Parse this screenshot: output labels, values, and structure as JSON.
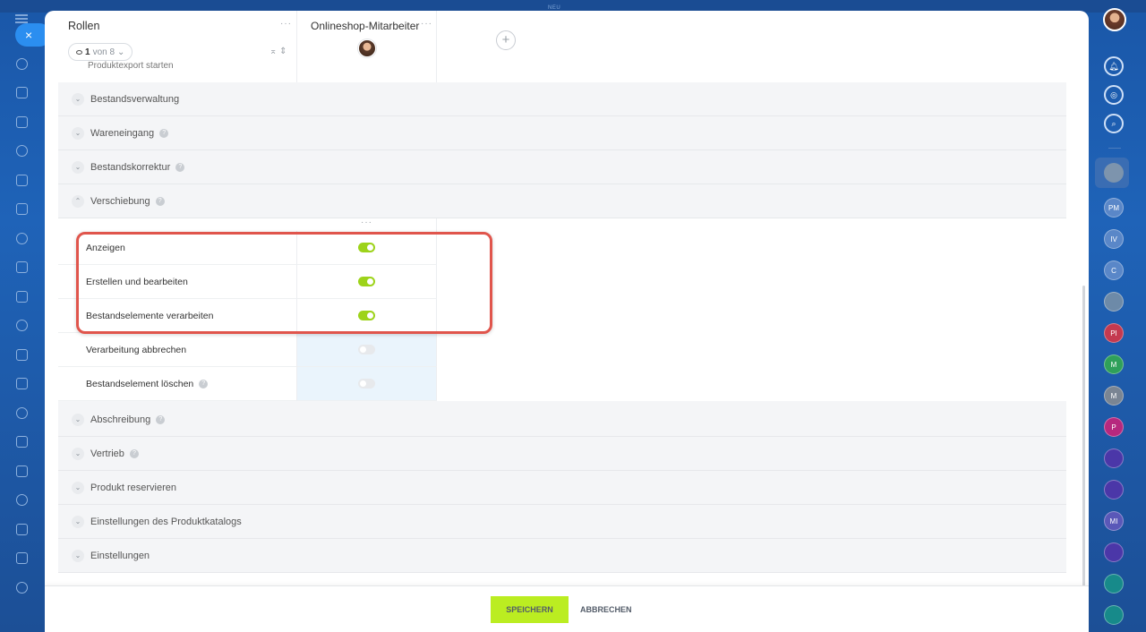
{
  "top_strip": {
    "label": "NEU"
  },
  "left_sidebar": {
    "close_label": "×",
    "icons": [
      "home-icon",
      "puzzle-icon",
      "feed-icon",
      "contacts-icon",
      "document-icon",
      "inbox-icon",
      "sites-icon",
      "chat-icon",
      "calendar-icon",
      "tasks-icon",
      "analytics-icon",
      "filter-icon",
      "shop-icon",
      "settings-icon",
      "sign-icon",
      "storage-icon",
      "widgets-icon",
      "groups-icon",
      "misc-icon"
    ]
  },
  "right_sidebar": {
    "icons": [
      {
        "name": "bell-icon",
        "text": ""
      },
      {
        "name": "copilot-icon",
        "text": ""
      },
      {
        "name": "search-chat-icon",
        "text": ""
      }
    ],
    "avatars": [
      {
        "name": "avatar-pm",
        "text": "PM",
        "color": "#5a87c8"
      },
      {
        "name": "avatar-iv",
        "text": "IV",
        "color": "#5a87c8"
      },
      {
        "name": "avatar-c",
        "text": "C",
        "color": "#5a87c8"
      },
      {
        "name": "avatar-photo",
        "text": "",
        "color": "#6d8aa8"
      },
      {
        "name": "avatar-pi",
        "text": "PI",
        "color": "#c4394f"
      },
      {
        "name": "avatar-m-green",
        "text": "M",
        "color": "#2fa05a"
      },
      {
        "name": "avatar-m-grey",
        "text": "M",
        "color": "#7a8593"
      },
      {
        "name": "avatar-p",
        "text": "P",
        "color": "#b6287e"
      },
      {
        "name": "channel-icon-1",
        "text": "",
        "color": "#4b37a8"
      },
      {
        "name": "channel-icon-2",
        "text": "",
        "color": "#4b37a8"
      },
      {
        "name": "avatar-mi",
        "text": "MI",
        "color": "#5a58b8"
      },
      {
        "name": "channel-icon-3",
        "text": "",
        "color": "#4b37a8"
      },
      {
        "name": "check-chat-icon",
        "text": "",
        "color": "#178a8a"
      },
      {
        "name": "lock-chat-icon",
        "text": "",
        "color": "#178a8a"
      }
    ]
  },
  "header": {
    "column_title": "Rollen",
    "pager": {
      "current": "1",
      "of_text": "von 8"
    },
    "cut_row_text": "Produktexport starten",
    "role_name": "Onlineshop-Mitarbeiter",
    "more": "···",
    "add_symbol": "+"
  },
  "sections_top": [
    {
      "label": "Bestandsverwaltung",
      "help": false
    },
    {
      "label": "Wareneingang",
      "help": true
    },
    {
      "label": "Bestandskorrektur",
      "help": true
    },
    {
      "label": "Verschiebung",
      "help": true,
      "expanded": true
    }
  ],
  "permissions": [
    {
      "label": "Anzeigen",
      "enabled": true,
      "help": false
    },
    {
      "label": "Erstellen und bearbeiten",
      "enabled": true,
      "help": false
    },
    {
      "label": "Bestandselemente verarbeiten",
      "enabled": true,
      "help": false
    },
    {
      "label": "Verarbeitung abbrechen",
      "enabled": false,
      "help": false
    },
    {
      "label": "Bestandselement löschen",
      "enabled": false,
      "help": true
    }
  ],
  "sections_bottom": [
    {
      "label": "Abschreibung",
      "help": true
    },
    {
      "label": "Vertrieb",
      "help": true
    },
    {
      "label": "Produkt reservieren",
      "help": false
    },
    {
      "label": "Einstellungen des Produktkatalogs",
      "help": false
    },
    {
      "label": "Einstellungen",
      "help": false
    }
  ],
  "footer": {
    "save_label": "SPEICHERN",
    "cancel_label": "ABBRECHEN"
  },
  "colors": {
    "toggle_on": "#9dd31a",
    "save_button": "#bbed21",
    "highlight": "#e0554c"
  }
}
